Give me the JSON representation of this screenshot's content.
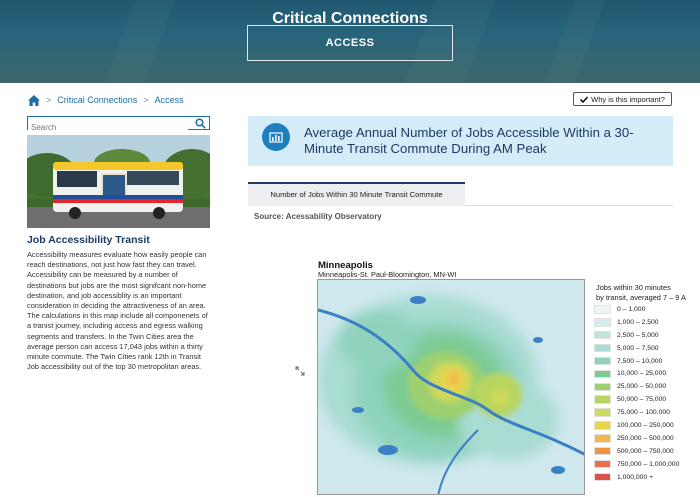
{
  "hero": {
    "title": "Critical Connections",
    "subtitle": "ACCESS"
  },
  "breadcrumb": {
    "home_icon": "home-icon",
    "items": [
      "Critical Connections",
      "Access"
    ]
  },
  "why_button": {
    "icon": "check-icon",
    "label": "Why is this important?"
  },
  "sidebar": {
    "search_placeholder": "Search",
    "search_icon": "search-icon",
    "photo_label": "transit-bus-photo",
    "title": "Job Accessibility Transit",
    "body": "Accessibility measures evaluate how easily people can reach destinations, not just how fast they can travel. Accessibility can be measured by a number of destinations but jobs are the most signifcant non-home destination, and job accessiblity is an important consideration in deciding the attractiveness of an area. The calculations in this map include all componenets of a tranist journey, including access and egress walking segments and transfers.  In the Twin Cities area the average person can access 17,043 jobs within a thirty minute commute. The Twin Cities rank 12th in Transit Job accessibility out of the top 30 metropolitan areas."
  },
  "main": {
    "heading_icon": "bar-chart-icon",
    "heading": "Average Annual Number of Jobs Accessible Within a 30-Minute Transit Commute During AM Peak",
    "tab_label": "Number of Jobs Within 30 Minute Transit Commute",
    "source": "Source: Acessability Observatory",
    "expand_icon": "expand-arrows-icon",
    "map": {
      "title": "Minneapolis",
      "subtitle": "Minneapolis-St. Paul-Bloomington, MN-WI",
      "legend_title_line1": "Jobs within 30 minutes",
      "legend_title_line2": "by transit, averaged 7 – 9 A",
      "legend": [
        {
          "label": "0 – 1,000",
          "color": "#eef6f8"
        },
        {
          "label": "1,000 – 2,500",
          "color": "#d6ecf0"
        },
        {
          "label": "2,500 – 5,000",
          "color": "#c1e4e3"
        },
        {
          "label": "5,000 – 7,500",
          "color": "#a9dcd2"
        },
        {
          "label": "7,500 – 10,000",
          "color": "#8fd3bd"
        },
        {
          "label": "10,000 – 25,000",
          "color": "#7dcb93"
        },
        {
          "label": "25,000 – 50,000",
          "color": "#9fd06f"
        },
        {
          "label": "50,000 – 75,000",
          "color": "#b8d561"
        },
        {
          "label": "75,000 – 100,000",
          "color": "#cfd95a"
        },
        {
          "label": "100,000 – 250,000",
          "color": "#e8d44d"
        },
        {
          "label": "250,000 – 500,000",
          "color": "#f2b84a"
        },
        {
          "label": "500,000 – 750,000",
          "color": "#ef9347"
        },
        {
          "label": "750,000 – 1,000,000",
          "color": "#e8704a"
        },
        {
          "label": "1,000,000 +",
          "color": "#d9504c"
        }
      ]
    }
  }
}
